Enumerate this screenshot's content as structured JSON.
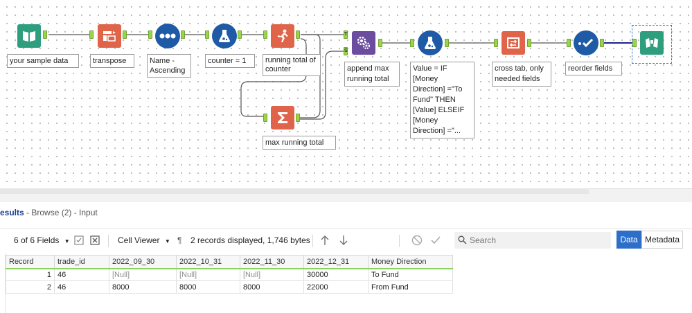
{
  "canvas": {
    "tools": [
      {
        "id": "input",
        "label": "your sample data",
        "icon": "book-icon"
      },
      {
        "id": "transpose",
        "label": "transpose",
        "icon": "transpose-icon"
      },
      {
        "id": "sort",
        "label": "Name - Ascending",
        "icon": "sort-dots-icon"
      },
      {
        "id": "formula",
        "label": "counter = 1",
        "icon": "flask-icon"
      },
      {
        "id": "running-total",
        "label": "running total of counter",
        "icon": "running-man-icon"
      },
      {
        "id": "summarize",
        "label": "max running total",
        "icon": "sigma-icon"
      },
      {
        "id": "append",
        "label": "append max running total",
        "icon": "gears-icon"
      },
      {
        "id": "formula2",
        "label": "Value = IF [Money Direction] =\"To Fund\" THEN [Value] ELSEIF [Money Direction] =\"...",
        "icon": "flask-icon"
      },
      {
        "id": "crosstab",
        "label": "cross tab, only needed fields",
        "icon": "crosstab-icon"
      },
      {
        "id": "select",
        "label": "reorder fields",
        "icon": "check-icon"
      },
      {
        "id": "browse",
        "label": "",
        "icon": "binoculars-icon"
      }
    ],
    "anchor_labels": {
      "target": "T",
      "source": "S"
    }
  },
  "results": {
    "title": "esults",
    "subtitle": " - Browse (2) - Input"
  },
  "toolbar": {
    "fields": "6 of 6 Fields",
    "viewer": "Cell Viewer",
    "pilcrow": "¶",
    "records": "2 records displayed, 1,746 bytes",
    "search_placeholder": "Search",
    "data_label": "Data",
    "metadata_label": "Metadata"
  },
  "grid": {
    "columns": [
      "Record",
      "trade_id",
      "2022_09_30",
      "2022_10_31",
      "2022_11_30",
      "2022_12_31",
      "Money Direction"
    ],
    "rows": [
      [
        "1",
        "46",
        "[Null]",
        "[Null]",
        "[Null]",
        "30000",
        "To Fund"
      ],
      [
        "2",
        "46",
        "8000",
        "8000",
        "8000",
        "22000",
        "From Fund"
      ]
    ]
  },
  "colors": {
    "input": "#2f9e7f",
    "transform": "#e0644a",
    "prep": "#1f5aa6",
    "join": "#6c4c9e",
    "anchor": "#9bd44b",
    "data_btn": "#2c6ec9"
  }
}
